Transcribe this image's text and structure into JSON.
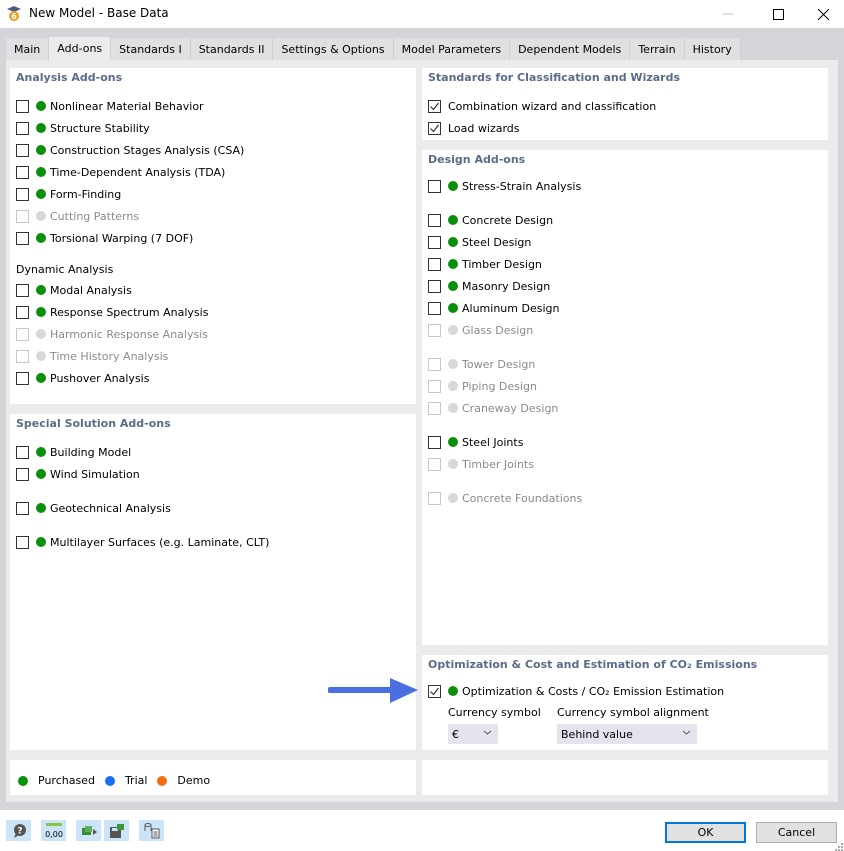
{
  "window": {
    "title": "New Model - Base Data",
    "minimize_icon": "minimize-icon",
    "maximize_icon": "maximize-icon",
    "close_icon": "close-icon"
  },
  "tabs": [
    {
      "label": "Main",
      "active": false
    },
    {
      "label": "Add-ons",
      "active": true
    },
    {
      "label": "Standards I",
      "active": false
    },
    {
      "label": "Standards II",
      "active": false
    },
    {
      "label": "Settings & Options",
      "active": false
    },
    {
      "label": "Model Parameters",
      "active": false
    },
    {
      "label": "Dependent Models",
      "active": false
    },
    {
      "label": "Terrain",
      "active": false
    },
    {
      "label": "History",
      "active": false
    }
  ],
  "colors": {
    "purchased": "#0a8f0a",
    "trial": "#1a6ef5",
    "demo": "#f26d0f",
    "unavailable": "#d8d8dc",
    "section_title": "#5a6b8c",
    "arrow": "#4a6fe0"
  },
  "analysis_addons": {
    "title": "Analysis Add-ons",
    "items": [
      {
        "label": "Nonlinear Material Behavior",
        "checked": false,
        "enabled": true,
        "status": "purchased"
      },
      {
        "label": "Structure Stability",
        "checked": false,
        "enabled": true,
        "status": "purchased"
      },
      {
        "label": "Construction Stages Analysis (CSA)",
        "checked": false,
        "enabled": true,
        "status": "purchased"
      },
      {
        "label": "Time-Dependent Analysis (TDA)",
        "checked": false,
        "enabled": true,
        "status": "purchased"
      },
      {
        "label": "Form-Finding",
        "checked": false,
        "enabled": true,
        "status": "purchased"
      },
      {
        "label": "Cutting Patterns",
        "checked": false,
        "enabled": false,
        "status": "unavailable"
      },
      {
        "label": "Torsional Warping (7 DOF)",
        "checked": false,
        "enabled": true,
        "status": "purchased"
      }
    ],
    "dynamic_title": "Dynamic Analysis",
    "dynamic_items": [
      {
        "label": "Modal Analysis",
        "checked": false,
        "enabled": true,
        "status": "purchased"
      },
      {
        "label": "Response Spectrum Analysis",
        "checked": false,
        "enabled": true,
        "status": "purchased"
      },
      {
        "label": "Harmonic Response Analysis",
        "checked": false,
        "enabled": false,
        "status": "unavailable"
      },
      {
        "label": "Time History Analysis",
        "checked": false,
        "enabled": false,
        "status": "unavailable"
      },
      {
        "label": "Pushover Analysis",
        "checked": false,
        "enabled": true,
        "status": "purchased"
      }
    ]
  },
  "special_solution_addons": {
    "title": "Special Solution Add-ons",
    "items": [
      {
        "label": "Building Model",
        "checked": false,
        "enabled": true,
        "status": "purchased"
      },
      {
        "label": "Wind Simulation",
        "checked": false,
        "enabled": true,
        "status": "purchased"
      },
      {
        "label": "Geotechnical Analysis",
        "checked": false,
        "enabled": true,
        "status": "purchased"
      },
      {
        "label": "Multilayer Surfaces (e.g. Laminate, CLT)",
        "checked": false,
        "enabled": true,
        "status": "purchased"
      }
    ]
  },
  "standards_wizards": {
    "title": "Standards for Classification and Wizards",
    "items": [
      {
        "label": "Combination wizard and classification",
        "checked": true
      },
      {
        "label": "Load wizards",
        "checked": true
      }
    ]
  },
  "design_addons": {
    "title": "Design Add-ons",
    "items": [
      {
        "label": "Stress-Strain Analysis",
        "checked": false,
        "enabled": true,
        "status": "purchased"
      },
      {
        "label": "Concrete Design",
        "checked": false,
        "enabled": true,
        "status": "purchased"
      },
      {
        "label": "Steel Design",
        "checked": false,
        "enabled": true,
        "status": "purchased"
      },
      {
        "label": "Timber Design",
        "checked": false,
        "enabled": true,
        "status": "purchased"
      },
      {
        "label": "Masonry Design",
        "checked": false,
        "enabled": true,
        "status": "purchased"
      },
      {
        "label": "Aluminum Design",
        "checked": false,
        "enabled": true,
        "status": "purchased"
      },
      {
        "label": "Glass Design",
        "checked": false,
        "enabled": false,
        "status": "unavailable"
      },
      {
        "label": "Tower Design",
        "checked": false,
        "enabled": false,
        "status": "unavailable"
      },
      {
        "label": "Piping Design",
        "checked": false,
        "enabled": false,
        "status": "unavailable"
      },
      {
        "label": "Craneway Design",
        "checked": false,
        "enabled": false,
        "status": "unavailable"
      },
      {
        "label": "Steel Joints",
        "checked": false,
        "enabled": true,
        "status": "purchased"
      },
      {
        "label": "Timber Joints",
        "checked": false,
        "enabled": false,
        "status": "unavailable"
      },
      {
        "label": "Concrete Foundations",
        "checked": false,
        "enabled": false,
        "status": "unavailable"
      }
    ]
  },
  "optimization": {
    "title": "Optimization & Cost and Estimation of CO₂ Emissions",
    "item": {
      "label": "Optimization & Costs / CO₂ Emission Estimation",
      "checked": true,
      "enabled": true,
      "status": "purchased"
    },
    "currency_symbol_label": "Currency symbol",
    "currency_symbol_value": "€",
    "alignment_label": "Currency symbol alignment",
    "alignment_value": "Behind value"
  },
  "legend": [
    {
      "label": "Purchased",
      "status": "purchased"
    },
    {
      "label": "Trial",
      "status": "trial"
    },
    {
      "label": "Demo",
      "status": "demo"
    }
  ],
  "footer": {
    "toolbar_icons": [
      "help-icon",
      "units-decimal-icon",
      "export-model-icon",
      "save-template-icon",
      "import-data-icon"
    ],
    "units_text": "0,00",
    "ok_label": "OK",
    "cancel_label": "Cancel"
  }
}
